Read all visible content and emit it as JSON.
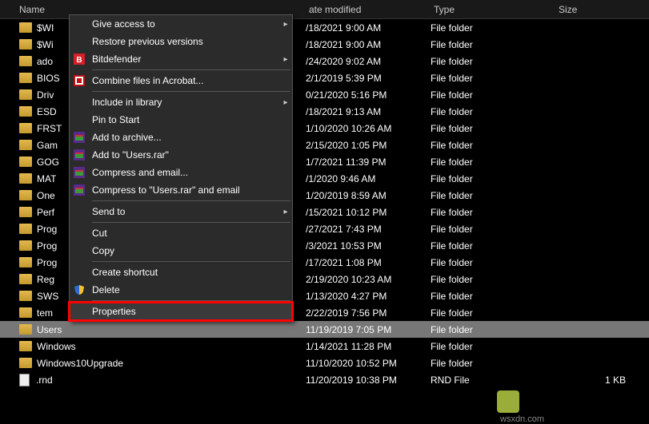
{
  "columns": {
    "name": "Name",
    "date": "ate modified",
    "type": "Type",
    "size": "Size"
  },
  "rows": [
    {
      "name": "$WI",
      "date": "/18/2021 9:00 AM",
      "type": "File folder",
      "size": "",
      "icon": "folder",
      "selected": false
    },
    {
      "name": "$Wi",
      "date": "/18/2021 9:00 AM",
      "type": "File folder",
      "size": "",
      "icon": "folder",
      "selected": false
    },
    {
      "name": "ado",
      "date": "/24/2020 9:02 AM",
      "type": "File folder",
      "size": "",
      "icon": "folder",
      "selected": false
    },
    {
      "name": "BIOS",
      "date": "2/1/2019 5:39 PM",
      "type": "File folder",
      "size": "",
      "icon": "folder",
      "selected": false
    },
    {
      "name": "Driv",
      "date": "0/21/2020 5:16 PM",
      "type": "File folder",
      "size": "",
      "icon": "folder",
      "selected": false
    },
    {
      "name": "ESD",
      "date": "/18/2021 9:13 AM",
      "type": "File folder",
      "size": "",
      "icon": "folder",
      "selected": false
    },
    {
      "name": "FRST",
      "date": "1/10/2020 10:26 AM",
      "type": "File folder",
      "size": "",
      "icon": "folder",
      "selected": false
    },
    {
      "name": "Gam",
      "date": "2/15/2020 1:05 PM",
      "type": "File folder",
      "size": "",
      "icon": "folder",
      "selected": false
    },
    {
      "name": "GOG",
      "date": "1/7/2021 11:39 PM",
      "type": "File folder",
      "size": "",
      "icon": "folder",
      "selected": false
    },
    {
      "name": "MAT",
      "date": "/1/2020 9:46 AM",
      "type": "File folder",
      "size": "",
      "icon": "folder",
      "selected": false
    },
    {
      "name": "One",
      "date": "1/20/2019 8:59 AM",
      "type": "File folder",
      "size": "",
      "icon": "folder",
      "selected": false
    },
    {
      "name": "Perf",
      "date": "/15/2021 10:12 PM",
      "type": "File folder",
      "size": "",
      "icon": "folder",
      "selected": false
    },
    {
      "name": "Prog",
      "date": "/27/2021 7:43 PM",
      "type": "File folder",
      "size": "",
      "icon": "folder",
      "selected": false
    },
    {
      "name": "Prog",
      "date": "/3/2021 10:53 PM",
      "type": "File folder",
      "size": "",
      "icon": "folder",
      "selected": false
    },
    {
      "name": "Prog",
      "date": "/17/2021 1:08 PM",
      "type": "File folder",
      "size": "",
      "icon": "folder",
      "selected": false
    },
    {
      "name": "Reg",
      "date": "2/19/2020 10:23 AM",
      "type": "File folder",
      "size": "",
      "icon": "folder",
      "selected": false
    },
    {
      "name": "SWS",
      "date": "1/13/2020 4:27 PM",
      "type": "File folder",
      "size": "",
      "icon": "folder",
      "selected": false
    },
    {
      "name": "tem",
      "date": "2/22/2019 7:56 PM",
      "type": "File folder",
      "size": "",
      "icon": "folder",
      "selected": false
    },
    {
      "name": "Users",
      "date": "11/19/2019 7:05 PM",
      "type": "File folder",
      "size": "",
      "icon": "folder",
      "selected": true
    },
    {
      "name": "Windows",
      "date": "1/14/2021 11:28 PM",
      "type": "File folder",
      "size": "",
      "icon": "folder",
      "selected": false
    },
    {
      "name": "Windows10Upgrade",
      "date": "11/10/2020 10:52 PM",
      "type": "File folder",
      "size": "",
      "icon": "folder",
      "selected": false
    },
    {
      "name": ".rnd",
      "date": "11/20/2019 10:38 PM",
      "type": "RND File",
      "size": "1 KB",
      "icon": "file",
      "selected": false
    }
  ],
  "menu": {
    "give_access": "Give access to",
    "restore": "Restore previous versions",
    "bitdefender": "Bitdefender",
    "combine": "Combine files in Acrobat...",
    "include": "Include in library",
    "pin": "Pin to Start",
    "add_archive": "Add to archive...",
    "add_rar": "Add to \"Users.rar\"",
    "compress_email": "Compress and email...",
    "compress_rar_email": "Compress to \"Users.rar\" and email",
    "send_to": "Send to",
    "cut": "Cut",
    "copy": "Copy",
    "shortcut": "Create shortcut",
    "delete": "Delete",
    "properties": "Properties"
  },
  "watermark": "wsxdn.com"
}
